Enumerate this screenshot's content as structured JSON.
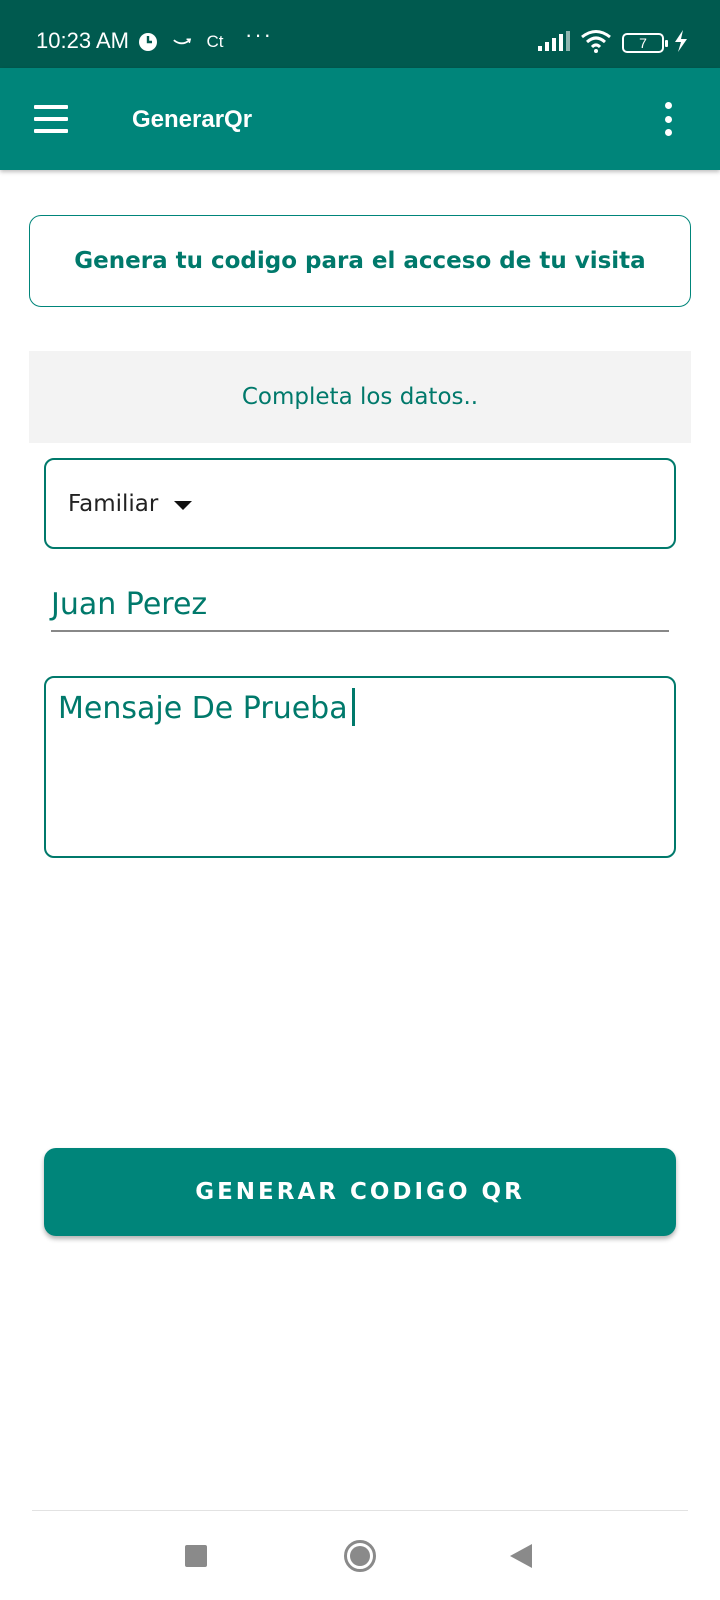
{
  "status_bar": {
    "time": "10:23 AM",
    "app_icons": [
      "clock-icon",
      "amazon-icon",
      "ct-icon"
    ],
    "ct_label": "Ct",
    "more": "···",
    "battery": "7",
    "right_icons": [
      "signal-icon",
      "wifi-icon",
      "battery-icon",
      "charging-icon"
    ]
  },
  "app_bar": {
    "title": "GenerarQr",
    "color": "#00857a"
  },
  "header_card": {
    "text": "Genera tu codigo para el acceso de tu visita"
  },
  "form": {
    "subtitle": "Completa los datos..",
    "visit_type": {
      "selected": "Familiar"
    },
    "name": {
      "value": "Juan Perez"
    },
    "message": {
      "value": "Mensaje De Prueba"
    }
  },
  "action": {
    "generate_label": "GENERAR CODIGO QR"
  },
  "colors": {
    "primary": "#00857a",
    "primary_dark": "#005a4f",
    "accent_text": "#00796b"
  }
}
